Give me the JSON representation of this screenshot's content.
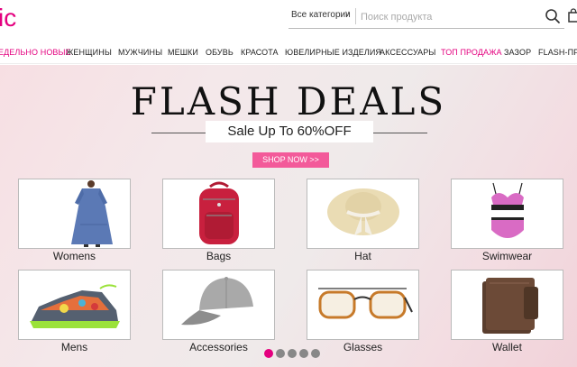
{
  "header": {
    "logo_text": "ic",
    "search": {
      "category_label": "Все категории",
      "placeholder": "Поиск продукта"
    }
  },
  "nav": {
    "items": [
      {
        "label": "ЕДЕЛЬНО НОВЫЕ",
        "highlight": true
      },
      {
        "label": "ЖЕНЩИНЫ",
        "highlight": false
      },
      {
        "label": "МУЖЧИНЫ",
        "highlight": false
      },
      {
        "label": "МЕШКИ",
        "highlight": false
      },
      {
        "label": "ОБУВЬ",
        "highlight": false
      },
      {
        "label": "КРАСОТА",
        "highlight": false
      },
      {
        "label": "ЮВЕЛИРНЫЕ ИЗДЕЛИЯ",
        "highlight": false
      },
      {
        "label": "АКСЕССУАРЫ",
        "highlight": false
      },
      {
        "label": "ТОП ПРОДАЖА",
        "highlight": true
      },
      {
        "label": "ЗАЗОР",
        "highlight": false
      },
      {
        "label": "FLASH-ПРЕ",
        "highlight": false
      }
    ]
  },
  "banner": {
    "title": "FLASH DEALS",
    "subtitle": "Sale Up To 60%OFF",
    "cta_label": "SHOP NOW >>",
    "categories": [
      {
        "label": "Womens",
        "icon": "dress-icon"
      },
      {
        "label": "Bags",
        "icon": "backpack-icon"
      },
      {
        "label": "Hat",
        "icon": "hat-icon"
      },
      {
        "label": "Swimwear",
        "icon": "swimsuit-icon"
      },
      {
        "label": "Mens",
        "icon": "sneaker-icon"
      },
      {
        "label": "Accessories",
        "icon": "cap-icon"
      },
      {
        "label": "Glasses",
        "icon": "glasses-icon"
      },
      {
        "label": "Wallet",
        "icon": "wallet-icon"
      }
    ]
  },
  "carousel": {
    "slide_count": 5,
    "active_slide": 1
  },
  "colors": {
    "brand": "#e4007f",
    "cta": "#f35a9a"
  }
}
